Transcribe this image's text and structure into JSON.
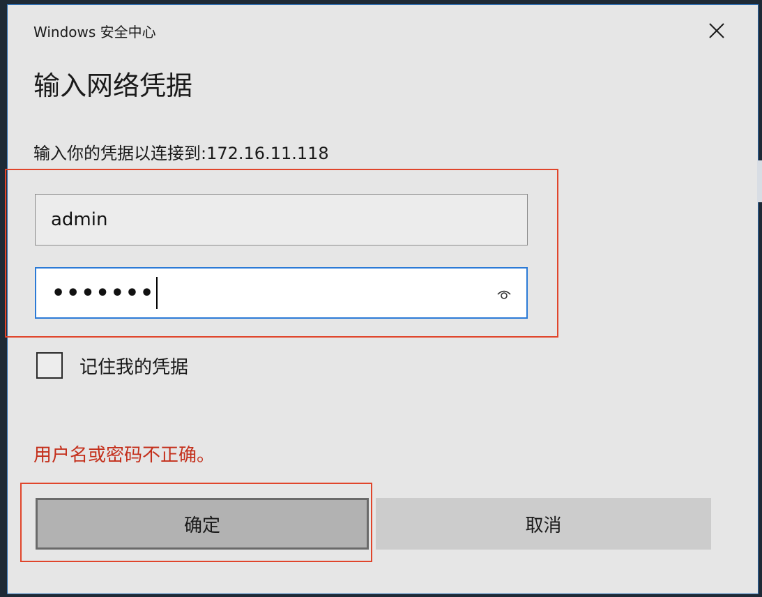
{
  "dialog": {
    "window_title": "Windows 安全中心",
    "heading": "输入网络凭据",
    "prompt": "输入你的凭据以连接到:172.16.11.118",
    "username": {
      "value": "admin"
    },
    "password": {
      "masked_value": "•••••••",
      "reveal_icon": "eye-icon"
    },
    "remember": {
      "label": "记住我的凭据",
      "checked": false
    },
    "error_message": "用户名或密码不正确。",
    "ok_label": "确定",
    "cancel_label": "取消",
    "close_icon": "close-icon"
  },
  "colors": {
    "dialog_bg": "#e6e6e6",
    "accent_border": "#2b7ad6",
    "error": "#c4301c",
    "annotation_highlight": "#e0452b"
  }
}
